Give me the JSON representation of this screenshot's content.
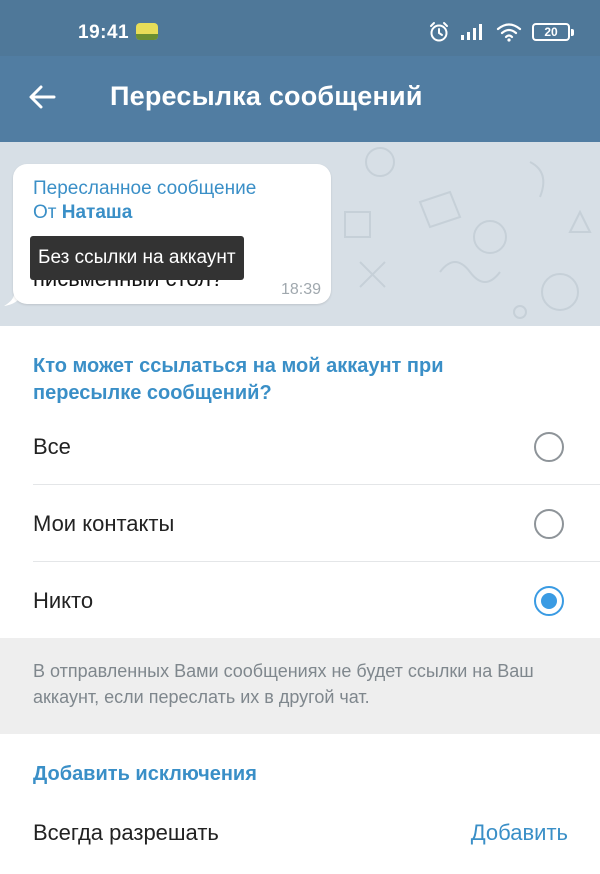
{
  "status_bar": {
    "time": "19:41",
    "battery": "20"
  },
  "app_bar": {
    "title": "Пересылка сообщений"
  },
  "preview": {
    "forwarded_header": "Пересланное сообщение",
    "from_prefix": "От ",
    "from_name": "Наташа",
    "message_text": "Чем ворон похож на письменный стол?",
    "time": "18:39",
    "tooltip": "Без ссылки на аккаунт"
  },
  "privacy": {
    "header": "Кто может ссылаться на мой аккаунт при пересылке сообщений?",
    "options": [
      {
        "label": "Все",
        "selected": false
      },
      {
        "label": "Мои контакты",
        "selected": false
      },
      {
        "label": "Никто",
        "selected": true
      }
    ],
    "info": "В отправленных Вами сообщениях не будет ссылки на Ваш аккаунт, если переслать их в другой чат."
  },
  "exceptions": {
    "header": "Добавить исключения",
    "always_allow_label": "Всегда разрешать",
    "add_label": "Добавить"
  },
  "colors": {
    "app_bar": "#517da2",
    "status_bar": "#4f7899",
    "accent": "#3a8fc7",
    "radio_checked": "#3a9be3"
  },
  "icons": {
    "back": "arrow-left-icon",
    "alarm": "alarm-clock-icon",
    "signal": "signal-bars-icon",
    "wifi": "wifi-icon",
    "battery": "battery-icon"
  }
}
